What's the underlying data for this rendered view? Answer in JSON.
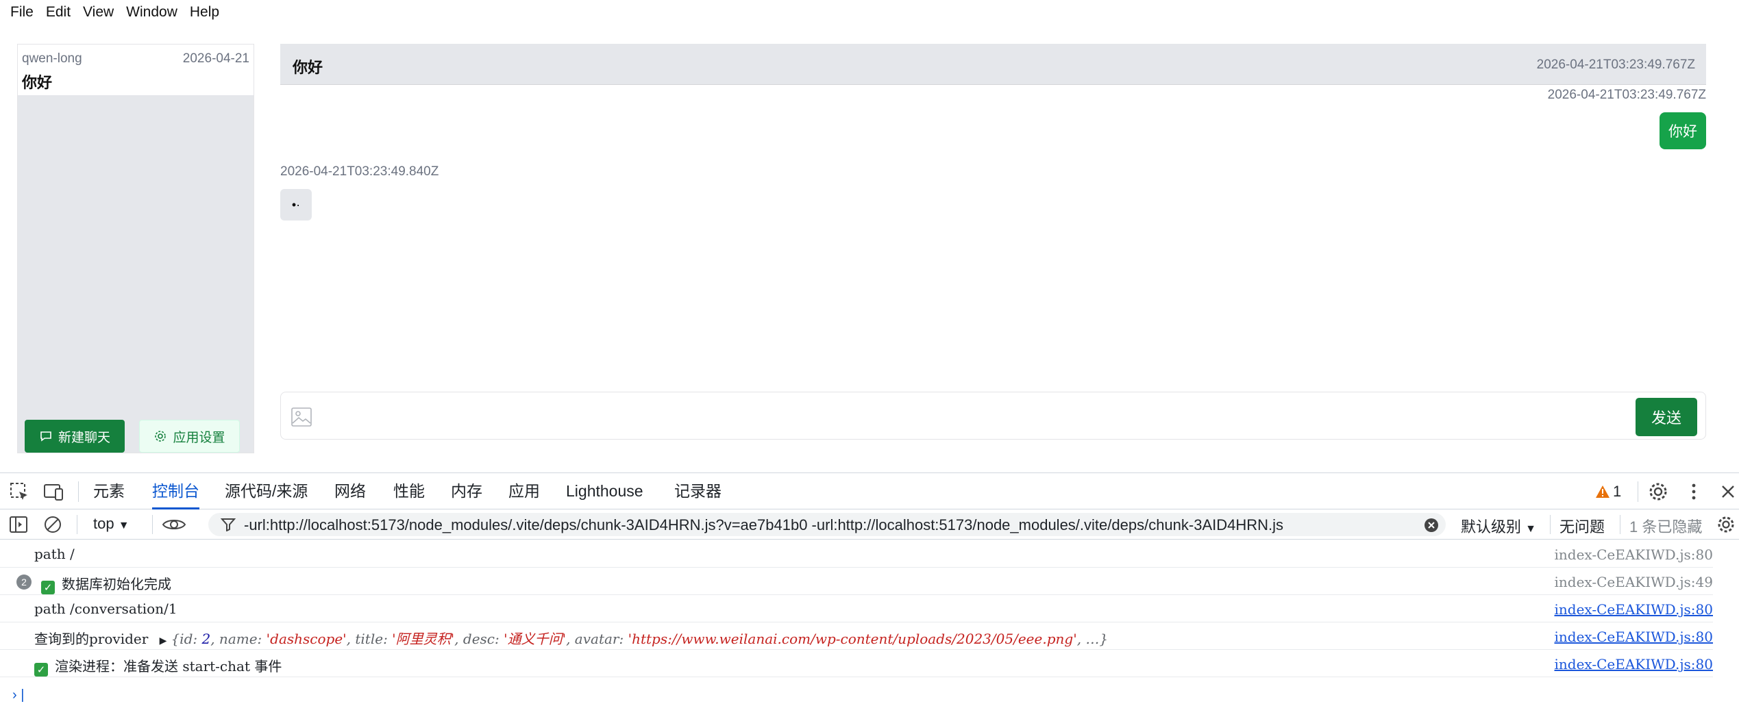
{
  "menu": [
    "File",
    "Edit",
    "View",
    "Window",
    "Help"
  ],
  "sidebar": {
    "conversation": {
      "provider": "qwen-long",
      "date": "2026-04-21",
      "title": "你好"
    },
    "new_chat_label": "新建聊天",
    "settings_label": "应用设置"
  },
  "chat": {
    "header_title": "你好",
    "header_time": "2026-04-21T03:23:49.767Z",
    "user_time": "2026-04-21T03:23:49.767Z",
    "user_message": "你好",
    "ai_time": "2026-04-21T03:23:49.840Z",
    "ai_message": "•·",
    "send_label": "发送"
  },
  "devtools": {
    "tabs": [
      "元素",
      "控制台",
      "源代码/来源",
      "网络",
      "性能",
      "内存",
      "应用",
      "Lighthouse",
      "记录器"
    ],
    "active_tab": "控制台",
    "warning_count": "1",
    "context": "top",
    "filter_text": "-url:http://localhost:5173/node_modules/.vite/deps/chunk-3AID4HRN.js?v=ae7b41b0 -url:http://localhost:5173/node_modules/.vite/deps/chunk-3AID4HRN.js",
    "level": "默认级别",
    "issues": "无问题",
    "hidden": "1 条已隐藏",
    "logs": [
      {
        "text": "path /",
        "source": "index-CeEAKIWD.js:80"
      },
      {
        "count": "2",
        "text": "数据库初始化完成",
        "source": "index-CeEAKIWD.js:49"
      },
      {
        "text": "path /conversation/1",
        "source": "index-CeEAKIWD.js:80"
      },
      {
        "label": "查询到的provider",
        "obj_open": "{id: ",
        "obj_id": "2",
        "obj_name_k": ", name: ",
        "obj_name": "'dashscope'",
        "obj_title_k": ", title: ",
        "obj_title": "'阿里灵积'",
        "obj_desc_k": ", desc: ",
        "obj_desc": "'通义千问'",
        "obj_avatar_k": ", avatar: ",
        "obj_avatar": "'https://www.weilanai.com/wp-content/uploads/2023/05/eee.png'",
        "obj_close": ",  …}",
        "source": "index-CeEAKIWD.js:80"
      },
      {
        "text": "渲染进程：准备发送 start-chat 事件",
        "source": "index-CeEAKIWD.js:80"
      }
    ]
  }
}
